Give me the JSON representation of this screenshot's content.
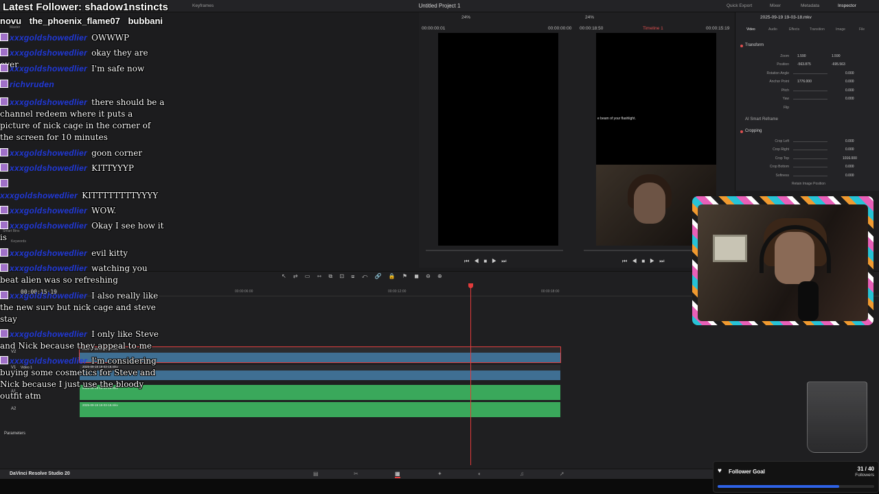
{
  "resolve": {
    "project_title": "Untitled Project 1",
    "top_left": {
      "keyframes": "Keyframes"
    },
    "top_right": [
      "Quick Export",
      "Mixer",
      "Metadata",
      "Inspector"
    ],
    "viewer": {
      "src_zoom": "24%",
      "tl_zoom": "24%",
      "src_tc": "00:00:00:01",
      "src_dur": "00:00:00:00",
      "tl_dur": "00:00:18:50",
      "tl_name": "Timeline 1",
      "tl_tc": "00:00:15:19",
      "caption": "e beam of your flashlight."
    },
    "inspector": {
      "file": "2025-09-19 19-03-18.mkv",
      "tabs": [
        "Video",
        "Audio",
        "Effects",
        "Transition",
        "Image",
        "File"
      ],
      "transform": "Transform",
      "rows": [
        {
          "label": "Zoom",
          "x": "1.590",
          "y": "1.590"
        },
        {
          "label": "Position",
          "x": "-563.875",
          "y": "-695.563"
        },
        {
          "label": "Rotation Angle",
          "v": "0.000"
        },
        {
          "label": "Anchor Point",
          "x": "1776.000",
          "v": "0.000"
        },
        {
          "label": "Pitch",
          "v": "0.000"
        },
        {
          "label": "Yaw",
          "v": "0.000"
        },
        {
          "label": "Flip",
          "v": ""
        }
      ],
      "smart_reframe": "AI Smart Reframe",
      "cropping": "Cropping",
      "crop_rows": [
        {
          "label": "Crop Left",
          "v": "0.000"
        },
        {
          "label": "Crop Right",
          "v": "0.000"
        },
        {
          "label": "Crop Top",
          "v": "1016.000"
        },
        {
          "label": "Crop Bottom",
          "v": "0.000"
        },
        {
          "label": "Softness",
          "v": "0.000"
        }
      ],
      "retain": "Retain Image Position"
    },
    "timeline": {
      "timecode": "00:00:15:19",
      "ruler": [
        "00:00:06:00",
        "00:00:12:00",
        "00:00:18:00"
      ],
      "clip_name": "2025-09-19 19-03-18.mkv",
      "tracks": [
        "V2",
        "V1",
        "A1",
        "A2"
      ],
      "v1_name": "Video 1",
      "params": "Parameters"
    },
    "brand": "DaVinci Resolve Studio 20",
    "left_labels": {
      "master": "Master",
      "smart_bins": "Smart Bins",
      "keywords": "Keywords"
    }
  },
  "overlay": {
    "latest_follower": "Latest Follower: shadow1nstincts",
    "ticker": "novu   the_phoenix_flame07   bubbani",
    "chat": [
      {
        "user": "xxxgoldshowedlier",
        "text": "OWWWP"
      },
      {
        "user": "xxxgoldshowedlier",
        "text": "okay they are over"
      },
      {
        "user": "xxxgoldshowedlier",
        "text": "I'm safe now"
      },
      {
        "user": "richvruden",
        "text": ""
      },
      {
        "user": "xxxgoldshowedlier",
        "text": "there should be a channel redeem where it puts a picture of nick cage in the corner of the screen for 10 minutes"
      },
      {
        "user": "xxxgoldshowedlier",
        "text": "goon corner"
      },
      {
        "user": "xxxgoldshowedlier",
        "text": "KITTYYYP"
      },
      {
        "user": "xxxgoldshowedlier",
        "text": "KITTTTTTTTYYYY"
      },
      {
        "user": "xxxgoldshowedlier",
        "text": "WOW."
      },
      {
        "user": "xxxgoldshowedlier",
        "text": "Okay I see how it is"
      },
      {
        "user": "xxxgoldshowedlier",
        "text": "evil kitty"
      },
      {
        "user": "xxxgoldshowedlier",
        "text": "watching you beat alien was so refreshing"
      },
      {
        "user": "xxxgoldshowedlier",
        "text": "I also really like the new surv but nick cage and steve stay"
      },
      {
        "user": "xxxgoldshowedlier",
        "text": "I only like Steve and Nick because they appeal to me"
      },
      {
        "user": "xxxgoldshowedlier",
        "text": "I'm considering buying some cosmetics for Steve and Nick because I just use the bloody outfit atm"
      }
    ],
    "goal": {
      "label": "Follower Goal",
      "count": "31 / 40",
      "sub": "Followers",
      "progress": 0.775
    },
    "colors": {
      "accent": "#e23b3b",
      "goal_bar": "#2e62e6",
      "clip_video": "#3f6f93",
      "clip_audio": "#3aa85b"
    }
  }
}
